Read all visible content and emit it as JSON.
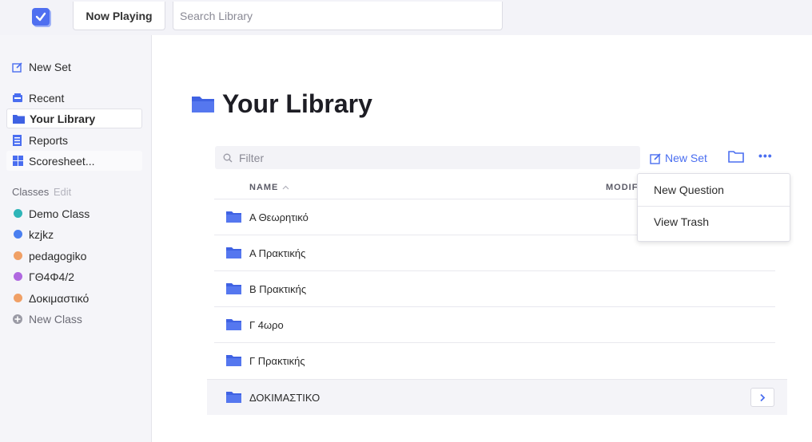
{
  "colors": {
    "accent": "#4a6ef0",
    "folder": "#3f62e3"
  },
  "topbar": {
    "logo_icon": "checkbox-logo-icon",
    "now_playing": "Now Playing",
    "search_placeholder": "Search Library"
  },
  "sidebar": {
    "new_set": "New Set",
    "recent": "Recent",
    "your_library": "Your Library",
    "reports": "Reports",
    "scoresheet": "Scoresheet...",
    "classes_label": "Classes",
    "classes_edit": "Edit",
    "classes": [
      {
        "name": "Demo Class",
        "color": "#2fb5b8"
      },
      {
        "name": "kzjkz",
        "color": "#4a7ff0"
      },
      {
        "name": "pedagogiko",
        "color": "#f0a066"
      },
      {
        "name": "ΓΘ4Φ4/2",
        "color": "#b068e0"
      },
      {
        "name": "Δοκιμαστικό",
        "color": "#f0a066"
      }
    ],
    "new_class": "New Class"
  },
  "main": {
    "title": "Your Library",
    "filter_placeholder": "Filter",
    "new_set_label": "New Set",
    "more_label": "•••",
    "col_name": "NAME",
    "col_modified": "MODIFIED",
    "rows": [
      {
        "name": "Α Θεωρητικό"
      },
      {
        "name": "Α Πρακτικής"
      },
      {
        "name": "Β Πρακτικής"
      },
      {
        "name": "Γ 4ωρο"
      },
      {
        "name": "Γ Πρακτικής"
      },
      {
        "name": "ΔΟΚΙΜΑΣΤΙΚΟ"
      }
    ]
  },
  "dropdown": {
    "items": [
      "New Question",
      "View Trash"
    ]
  }
}
